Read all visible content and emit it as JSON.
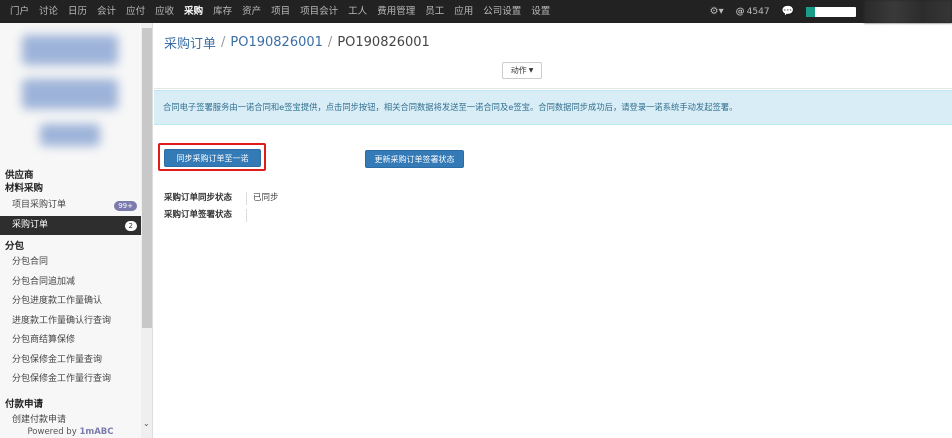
{
  "topnav": {
    "items": [
      "门户",
      "讨论",
      "日历",
      "会计",
      "应付",
      "应收",
      "采购",
      "库存",
      "资产",
      "项目",
      "项目会计",
      "工人",
      "费用管理",
      "员工",
      "应用",
      "公司设置",
      "设置"
    ],
    "active": "采购",
    "notifications": "4547",
    "accent_color": "#1a9c8a"
  },
  "sidebar": {
    "sections": [
      {
        "title": "供应商",
        "items": []
      },
      {
        "title": "材料采购",
        "items": [
          {
            "label": "项目采购订单",
            "badge": "99+"
          },
          {
            "label": "采购订单",
            "badge": "2",
            "active": true
          }
        ]
      },
      {
        "title": "分包",
        "items": [
          {
            "label": "分包合同"
          },
          {
            "label": "分包合同追加减"
          },
          {
            "label": "分包进度款工作量确认"
          },
          {
            "label": "进度款工作量确认行查询"
          },
          {
            "label": "分包商结算保修"
          },
          {
            "label": "分包保修金工作量查询"
          },
          {
            "label": "分包保修金工作量行查询"
          }
        ]
      },
      {
        "title": "付款申请",
        "items": [
          {
            "label": "创建付款申请"
          }
        ]
      }
    ],
    "powered_prefix": "Powered by",
    "powered_brand": "1mABC"
  },
  "breadcrumb": {
    "root": "采购订单",
    "middle": "PO190826001",
    "current": "PO190826001"
  },
  "action_button": "动作",
  "alert_text": "合同电子签署服务由一诺合同和e签宝提供，点击同步按钮，相关合同数据将发送至一诺合同及e签宝。合同数据同步成功后，请登录一诺系统手动发起签署。",
  "buttons": {
    "sync": "同步采购订单至一诺",
    "update": "更新采购订单签署状态"
  },
  "fields": [
    {
      "label": "采购订单同步状态",
      "value": "已同步"
    },
    {
      "label": "采购订单签署状态",
      "value": ""
    }
  ]
}
